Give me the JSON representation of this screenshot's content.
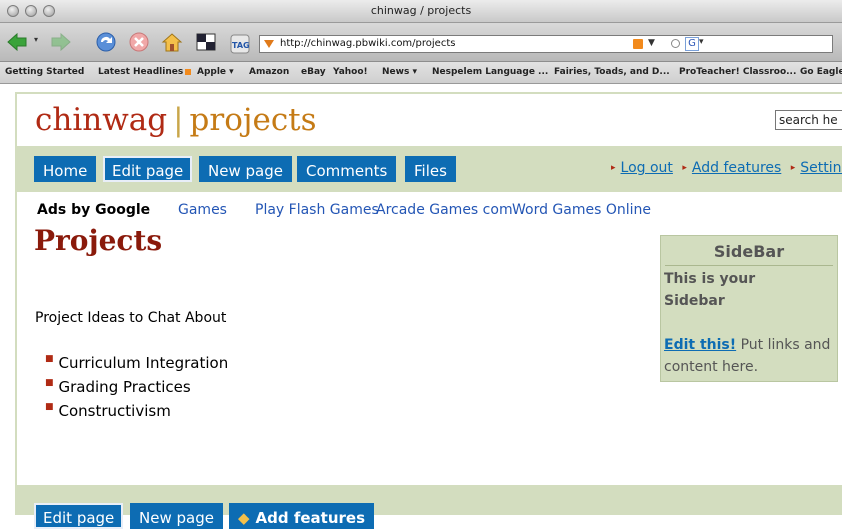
{
  "window": {
    "title": "chinwag / projects"
  },
  "toolbar": {
    "url": "http://chinwag.pbwiki.com/projects",
    "tag_label": "TAG",
    "google_letter": "G"
  },
  "bookmarks": [
    "Getting Started",
    "Latest Headlines",
    "Apple ▾",
    "Amazon",
    "eBay",
    "Yahoo!",
    "News ▾",
    "Nespelem Language ...",
    "Fairies, Toads, and D...",
    "ProTeacher! Classroo...",
    "Go Eagle"
  ],
  "site": {
    "name": "chinwag",
    "separator": "|",
    "section": "projects",
    "search_text": "search he"
  },
  "nav": {
    "buttons": [
      "Home",
      "Edit page",
      "New page",
      "Comments",
      "Files"
    ],
    "links": [
      "Log out",
      "Add features",
      "Setting"
    ]
  },
  "ads": {
    "label": "Ads by Google",
    "links": [
      "Games",
      "Play Flash Games",
      "Arcade Games com",
      "Word Games Online"
    ]
  },
  "page": {
    "heading": "Projects",
    "intro": "Project Ideas to Chat About",
    "items": [
      "Curriculum Integration",
      "Grading Practices",
      "Constructivism"
    ]
  },
  "sidebar": {
    "title": "SideBar",
    "text": "This is your Sidebar",
    "edit_link": "Edit this!",
    "edit_rest": " Put links and content here."
  },
  "bottom": {
    "buttons": [
      "Edit page",
      "New page",
      "Add features"
    ]
  },
  "colors": {
    "nav_blue": "#0d6cb3",
    "brand_red": "#b02a14",
    "brand_orange": "#c57b16",
    "frame_green": "#d3ddbf"
  }
}
